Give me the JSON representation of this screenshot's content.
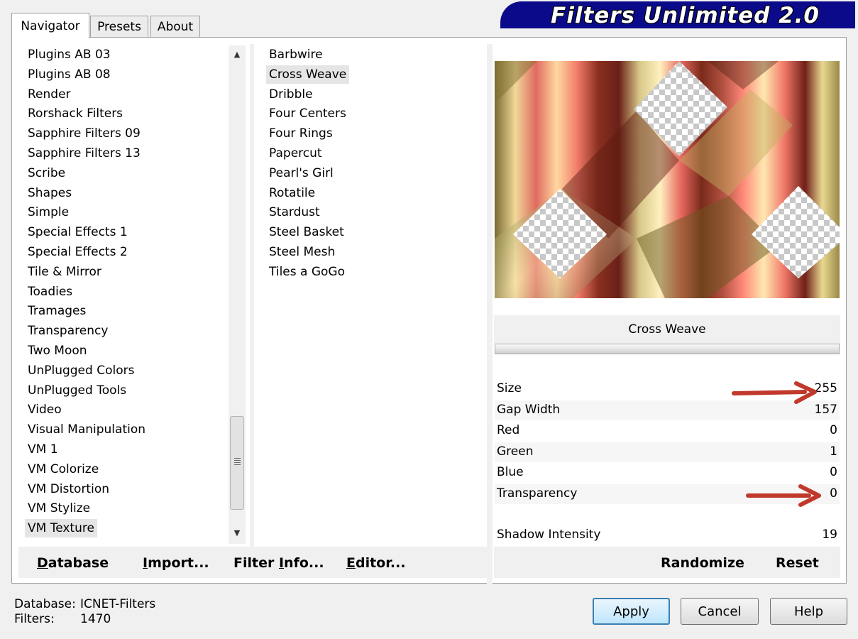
{
  "title": "Filters Unlimited 2.0",
  "tabs": [
    "Navigator",
    "Presets",
    "About"
  ],
  "categories": [
    "Plugins AB 03",
    "Plugins AB 08",
    "Render",
    "Rorshack Filters",
    "Sapphire Filters 09",
    "Sapphire Filters 13",
    "Scribe",
    "Shapes",
    "Simple",
    "Special Effects 1",
    "Special Effects 2",
    "Tile & Mirror",
    "Toadies",
    "Tramages",
    "Transparency",
    "Two Moon",
    "UnPlugged Colors",
    "UnPlugged Tools",
    "Video",
    "Visual Manipulation",
    "VM 1",
    "VM Colorize",
    "VM Distortion",
    "VM Stylize",
    "VM Texture"
  ],
  "filters": [
    "Barbwire",
    "Cross Weave",
    "Dribble",
    "Four Centers",
    "Four Rings",
    "Papercut",
    "Pearl's Girl",
    "Rotatile",
    "Stardust",
    "Steel Basket",
    "Steel Mesh",
    "Tiles a GoGo"
  ],
  "selected_filter_index": 1,
  "selected_category_index": 24,
  "bottom_left_buttons": {
    "database": {
      "u": "D",
      "rest": "atabase"
    },
    "import": {
      "u": "I",
      "rest": "mport..."
    },
    "filter_info": {
      "pre": "Filter ",
      "u": "I",
      "rest": "nfo..."
    },
    "editor": {
      "u": "E",
      "rest": "ditor..."
    }
  },
  "filter_name": "Cross Weave",
  "params": [
    {
      "label": "Size",
      "value": "255"
    },
    {
      "label": "Gap Width",
      "value": "157"
    },
    {
      "label": "Red",
      "value": "0"
    },
    {
      "label": "Green",
      "value": "1"
    },
    {
      "label": "Blue",
      "value": "0"
    },
    {
      "label": "Transparency",
      "value": "0"
    },
    {
      "label": "Shadow Intensity",
      "value": "19"
    }
  ],
  "randomize_label": "Randomize",
  "reset_label": "Reset",
  "footer": {
    "database_label": "Database:",
    "database_value": "ICNET-Filters",
    "filters_label": "Filters:",
    "filters_value": "1470"
  },
  "buttons": {
    "apply": "Apply",
    "cancel": "Cancel",
    "help": "Help"
  },
  "colors": {
    "banner": "#0a0a8a",
    "arrow": "#c0392b"
  }
}
